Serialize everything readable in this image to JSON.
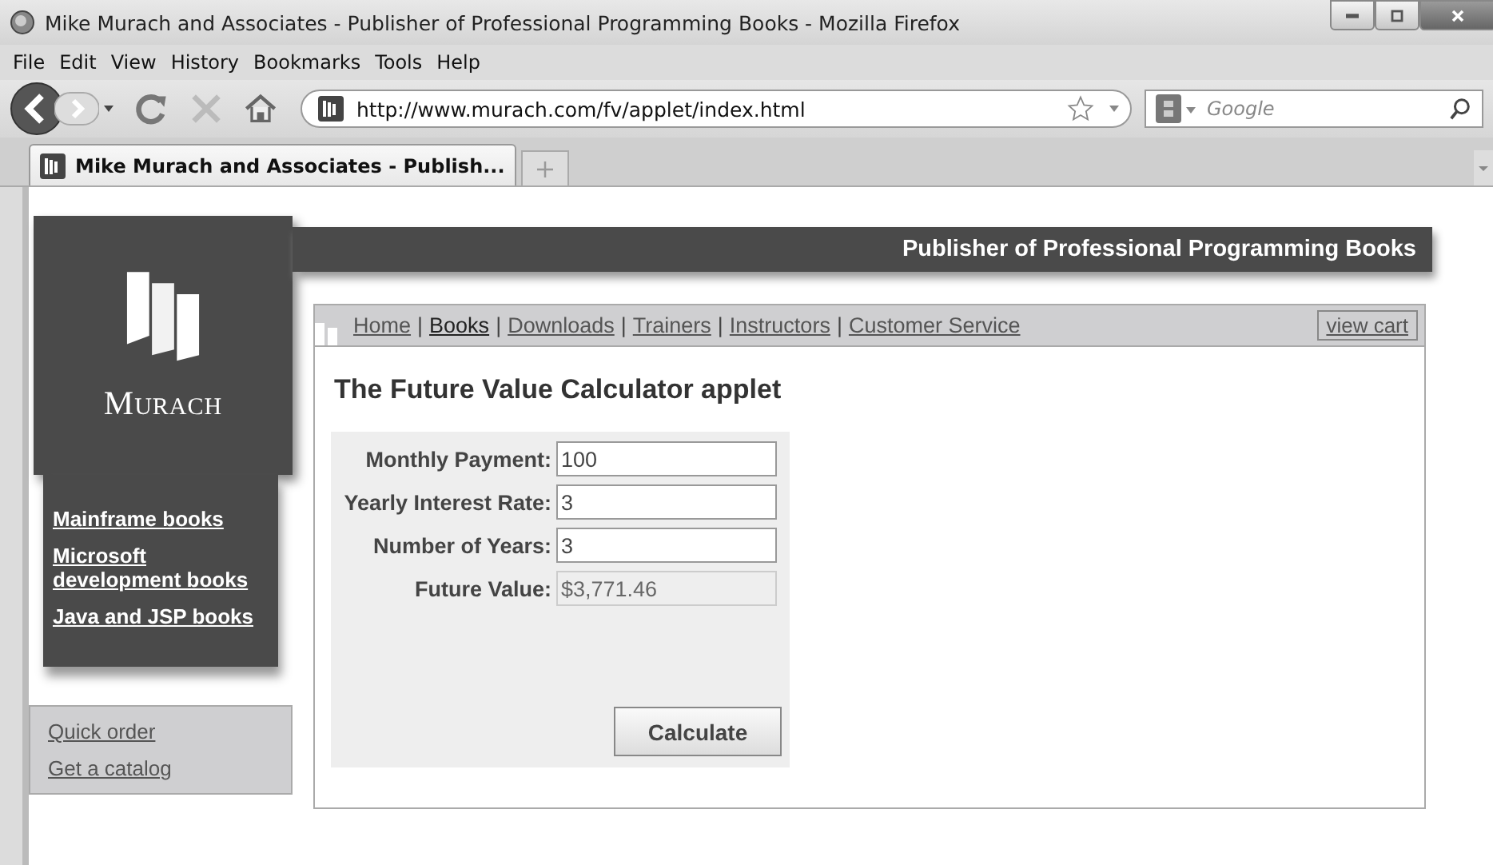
{
  "window": {
    "title": "Mike Murach and Associates - Publisher of Professional Programming Books - Mozilla Firefox"
  },
  "menu": [
    "File",
    "Edit",
    "View",
    "History",
    "Bookmarks",
    "Tools",
    "Help"
  ],
  "toolbar": {
    "url": "http://www.murach.com/fv/applet/index.html",
    "search_placeholder": "Google"
  },
  "tabs": [
    {
      "label": "Mike Murach and Associates - Publish...",
      "selected": true
    }
  ],
  "page": {
    "logo_text": "Murach",
    "tagline": "Publisher of Professional Programming Books",
    "nav": {
      "separator": "|",
      "links": [
        {
          "label": "Home",
          "selected": false
        },
        {
          "label": "Books",
          "selected": true
        },
        {
          "label": "Downloads",
          "selected": false
        },
        {
          "label": "Trainers",
          "selected": false
        },
        {
          "label": "Instructors",
          "selected": false
        },
        {
          "label": "Customer Service",
          "selected": false
        }
      ],
      "cart": "view cart"
    },
    "sidebar": [
      "Mainframe books",
      "Microsoft development books",
      "Java and JSP books"
    ],
    "quick_links": [
      "Quick order",
      "Get a catalog"
    ],
    "heading": "The Future Value Calculator applet",
    "applet": {
      "fields": [
        {
          "label": "Monthly Payment:",
          "value": "100",
          "disabled": false
        },
        {
          "label": "Yearly Interest Rate:",
          "value": "3",
          "disabled": false
        },
        {
          "label": "Number of Years:",
          "value": "3",
          "disabled": false
        },
        {
          "label": "Future Value:",
          "value": "$3,771.46",
          "disabled": true
        }
      ],
      "button": "Calculate"
    }
  }
}
